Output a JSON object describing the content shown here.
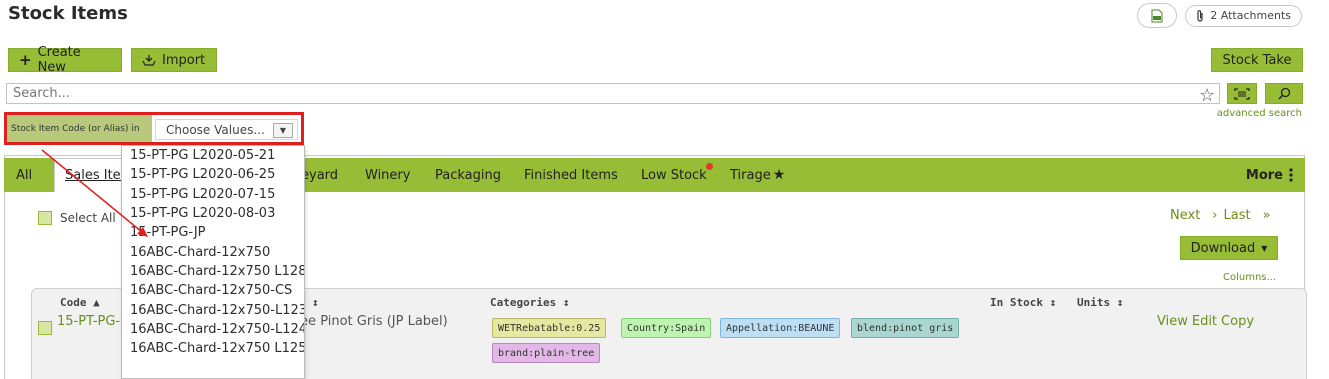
{
  "header": {
    "title": "Stock Items",
    "csv_icon": "csv-file-icon",
    "attachments_label": "2 Attachments"
  },
  "toolbar": {
    "create_label": "Create New",
    "import_label": "Import",
    "stock_take_label": "Stock Take"
  },
  "search": {
    "placeholder": "Search...",
    "advanced_label": "advanced search"
  },
  "filter": {
    "label": "Stock Item Code (or Alias) in",
    "select_placeholder": "Choose Values..."
  },
  "dropdown": {
    "options": [
      "15-PT-PG L2020-05-21",
      "15-PT-PG L2020-06-25",
      "15-PT-PG L2020-07-15",
      "15-PT-PG L2020-08-03",
      "15-PT-PG-JP",
      "16ABC-Chard-12x750",
      "16ABC-Chard-12x750 L128",
      "16ABC-Chard-12x750-CS",
      "16ABC-Chard-12x750-L123",
      "16ABC-Chard-12x750-L124",
      "16ABC-Chard-12x750 L125"
    ]
  },
  "tabs": {
    "all": "All",
    "sales": "Sales Iter",
    "vineyard": "eyard",
    "winery": "Winery",
    "packaging": "Packaging",
    "finished": "Finished Items",
    "low_stock": "Low Stock",
    "tirage": "Tirage",
    "more": "More"
  },
  "list": {
    "select_all": "Select All",
    "next": "Next",
    "last": "Last",
    "download": "Download",
    "columns": "Columns..."
  },
  "table": {
    "headers": {
      "code": "Code",
      "desc_sort": "↕",
      "categories": "Categories",
      "in_stock": "In Stock",
      "units": "Units"
    },
    "row": {
      "code": "15-PT-PG-",
      "description": "ree Pinot Gris (JP Label)",
      "tags": [
        "WETRebatable:0.25",
        "Country:Spain",
        "Appellation:BEAUNE",
        "blend:pinot gris",
        "brand:plain-tree"
      ],
      "actions": [
        "View",
        "Edit",
        "Copy"
      ]
    }
  },
  "colors": {
    "accent": "#97bd37",
    "link": "#6a8e1b",
    "highlight": "#e0201e"
  }
}
